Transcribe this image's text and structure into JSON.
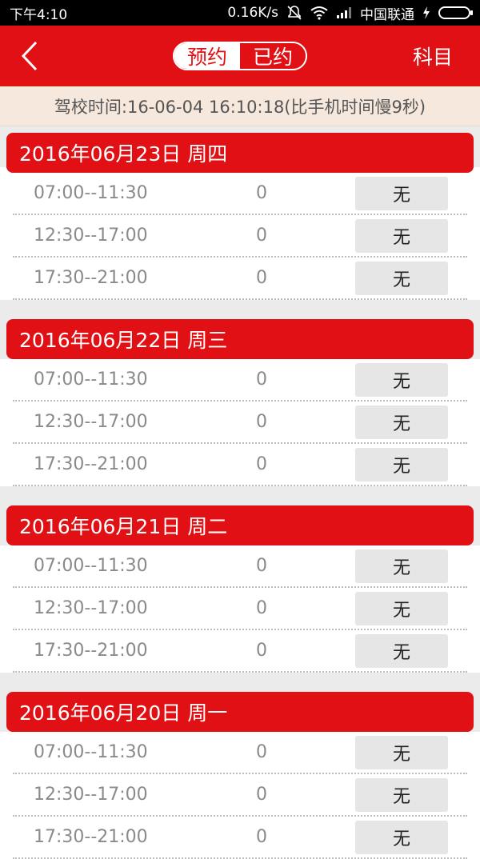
{
  "statusbar": {
    "time": "下午4:10",
    "speed": "0.16K/s",
    "carrier": "中国联通"
  },
  "header": {
    "tab_book": "预约",
    "tab_booked": "已约",
    "subject": "科目"
  },
  "notice": "驾校时间:16-06-04 16:10:18(比手机时间慢9秒)",
  "days": [
    {
      "date": "2016年06月23日   周四",
      "slots": [
        {
          "time": "07:00--11:30",
          "count": "0",
          "status": "无"
        },
        {
          "time": "12:30--17:00",
          "count": "0",
          "status": "无"
        },
        {
          "time": "17:30--21:00",
          "count": "0",
          "status": "无"
        }
      ]
    },
    {
      "date": "2016年06月22日   周三",
      "slots": [
        {
          "time": "07:00--11:30",
          "count": "0",
          "status": "无"
        },
        {
          "time": "12:30--17:00",
          "count": "0",
          "status": "无"
        },
        {
          "time": "17:30--21:00",
          "count": "0",
          "status": "无"
        }
      ]
    },
    {
      "date": "2016年06月21日   周二",
      "slots": [
        {
          "time": "07:00--11:30",
          "count": "0",
          "status": "无"
        },
        {
          "time": "12:30--17:00",
          "count": "0",
          "status": "无"
        },
        {
          "time": "17:30--21:00",
          "count": "0",
          "status": "无"
        }
      ]
    },
    {
      "date": "2016年06月20日   周一",
      "slots": [
        {
          "time": "07:00--11:30",
          "count": "0",
          "status": "无"
        },
        {
          "time": "12:30--17:00",
          "count": "0",
          "status": "无"
        },
        {
          "time": "17:30--21:00",
          "count": "0",
          "status": "无"
        }
      ]
    }
  ],
  "colors": {
    "brand_red": "#e11014",
    "notice_bg": "#f6e8dc"
  },
  "icons": {
    "back": "chevron-left-icon",
    "mute": "bell-off-icon",
    "wifi": "wifi-icon",
    "signal": "signal-icon",
    "battery": "battery-icon"
  }
}
